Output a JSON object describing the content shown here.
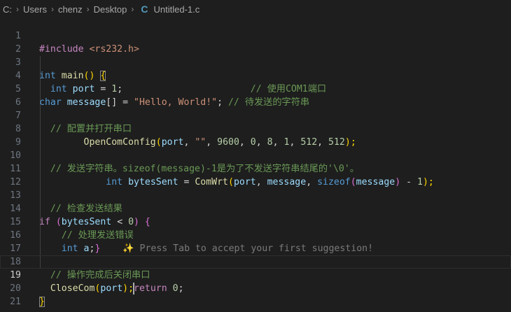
{
  "breadcrumb": {
    "drive": "C:",
    "folder1": "Users",
    "folder2": "chenz",
    "folder3": "Desktop",
    "file_icon": "C",
    "file": "Untitled-1.c"
  },
  "editor": {
    "current_line": 19,
    "lines": [
      {
        "n": "1"
      },
      {
        "n": "2"
      },
      {
        "n": "3"
      },
      {
        "n": "4"
      },
      {
        "n": "5"
      },
      {
        "n": "6"
      },
      {
        "n": "7"
      },
      {
        "n": "8"
      },
      {
        "n": "9"
      },
      {
        "n": "10"
      },
      {
        "n": "11"
      },
      {
        "n": "12"
      },
      {
        "n": "13"
      },
      {
        "n": "14"
      },
      {
        "n": "15"
      },
      {
        "n": "16"
      },
      {
        "n": "17"
      },
      {
        "n": "18"
      },
      {
        "n": "19"
      },
      {
        "n": "20"
      },
      {
        "n": "21"
      }
    ],
    "t": {
      "l1_pre": "#include",
      "l1_hdr": "<rs232.h>",
      "l3_int": "int",
      "l3_main": "main",
      "l3_parens": "()",
      "l3_brace": "{",
      "l4_int": "int",
      "l4_port": "port",
      "l4_eq": " = ",
      "l4_num": "1",
      "l4_semi": ";",
      "l4_cmt": "// 使用COM1端口",
      "l5_char": "char",
      "l5_msg": "message",
      "l5_rest": "[] = ",
      "l5_str": "\"Hello, World!\"",
      "l5_semi": "; ",
      "l5_cmt": "// 待发送的字符串",
      "l7_cmt": "// 配置并打开串口",
      "l8_fn": "OpenComConfig",
      "l8_open": "(",
      "l8_port": "port",
      "l8_c1": ", ",
      "l8_str": "\"\"",
      "l8_c2": ", ",
      "l8_n1": "9600",
      "l8_c3": ", ",
      "l8_n2": "0",
      "l8_c4": ", ",
      "l8_n3": "8",
      "l8_c5": ", ",
      "l8_n4": "1",
      "l8_c6": ", ",
      "l8_n5": "512",
      "l8_c7": ", ",
      "l8_n6": "512",
      "l8_close": ");",
      "l10_cmt": "// 发送字符串。sizeof(message)-1是为了不发送字符串结尾的'\\0'。",
      "l11_int": "int",
      "l11_var": "bytesSent",
      "l11_eq": " = ",
      "l11_fn": "ComWrt",
      "l11_open": "(",
      "l11_port": "port",
      "l11_c1": ", ",
      "l11_msg": "message",
      "l11_c2": ", ",
      "l11_sizeof": "sizeof",
      "l11_open2": "(",
      "l11_msg2": "message",
      "l11_close2": ")",
      "l11_minus": " - ",
      "l11_num": "1",
      "l11_close": ");",
      "l13_cmt": "// 检查发送结果",
      "l14_if": "if",
      "l14_open": " (",
      "l14_var": "bytesSent",
      "l14_lt": " < ",
      "l14_num": "0",
      "l14_close": ") ",
      "l14_brace": "{",
      "l15_cmt": "// 处理发送错误",
      "l16_int": "int",
      "l16_a": "a",
      "l16_semi": ";",
      "l16_brace": "}",
      "l16_ghost_icon": "✨",
      "l16_ghost": "Press Tab to accept your first suggestion!",
      "l18_cmt": "// 操作完成后关闭串口",
      "l19_fn": "CloseCom",
      "l19_open": "(",
      "l19_port": "port",
      "l19_close": ");",
      "l19_ret": "return",
      "l19_num": "0",
      "l19_semi": ";",
      "l20_brace": "}"
    }
  }
}
